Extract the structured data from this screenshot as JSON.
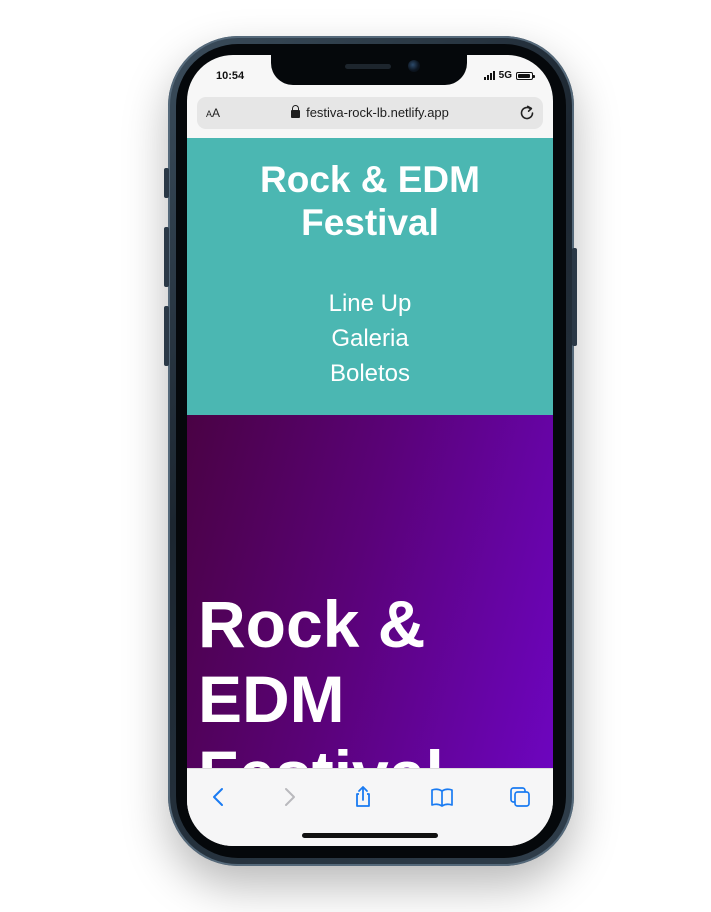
{
  "status_bar": {
    "time": "10:54",
    "network": "5G"
  },
  "browser": {
    "aa_label_small": "A",
    "aa_label_large": "A",
    "url": "festiva-rock-lb.netlify.app",
    "icons": [
      "lock-icon",
      "reload-icon",
      "back-icon",
      "forward-icon",
      "share-icon",
      "bookmarks-icon",
      "tabs-icon"
    ]
  },
  "site": {
    "header_title": "Rock & EDM Festival",
    "nav": [
      {
        "label": "Line Up"
      },
      {
        "label": "Galeria"
      },
      {
        "label": "Boletos"
      }
    ],
    "hero_title": "Rock & EDM Festival"
  },
  "colors": {
    "header_bg": "#4bb7b2",
    "hero_gradient_start": "#4a0244",
    "hero_gradient_end": "#6d05bf",
    "ios_blue": "#1a7bf2"
  }
}
